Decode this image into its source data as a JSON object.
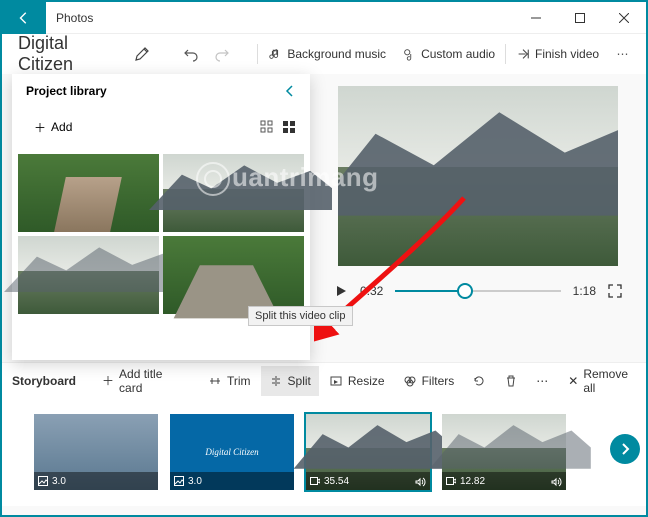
{
  "app": {
    "title": "Photos"
  },
  "toolbar": {
    "project_title": "Digital Citizen",
    "bg_music": "Background music",
    "custom_audio": "Custom audio",
    "finish_video": "Finish video"
  },
  "library": {
    "heading": "Project library",
    "add_label": "Add"
  },
  "player": {
    "current_time": "0:32",
    "total_time": "1:18"
  },
  "storyboard": {
    "title": "Storyboard",
    "add_title_card": "Add title card",
    "trim": "Trim",
    "split": "Split",
    "resize": "Resize",
    "filters": "Filters",
    "remove_all": "Remove all",
    "tooltip_split": "Split this video clip",
    "clips": [
      {
        "duration": "3.0"
      },
      {
        "duration": "3.0",
        "label": "Digital Citizen"
      },
      {
        "duration": "35.54"
      },
      {
        "duration": "12.82"
      }
    ]
  },
  "watermark": "uantrimang"
}
